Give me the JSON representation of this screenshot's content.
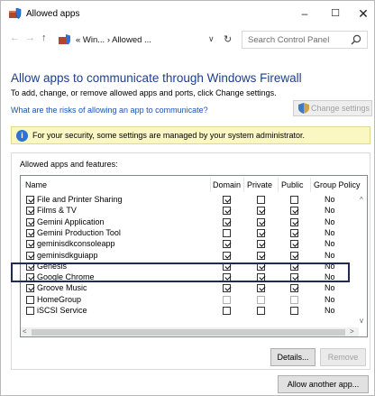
{
  "window": {
    "title": "Allowed apps",
    "minimize": "–",
    "maximize": "☐",
    "close": "✕"
  },
  "nav": {
    "back": "←",
    "forward": "→",
    "up": "↑",
    "address": "« Win... › Allowed ...",
    "dropdown": "∨",
    "refresh": "↻",
    "search_placeholder": "Search Control Panel"
  },
  "page": {
    "heading": "Allow apps to communicate through Windows Firewall",
    "subtitle": "To add, change, or remove allowed apps and ports, click Change settings.",
    "risk_link": "What are the risks of allowing an app to communicate?",
    "change_settings": "Change settings"
  },
  "banner": {
    "icon": "i",
    "text": "For your security, some settings are managed by your system administrator."
  },
  "group": {
    "label": "Allowed apps and features:",
    "columns": {
      "name": "Name",
      "domain": "Domain",
      "private": "Private",
      "public": "Public",
      "group_policy": "Group Policy"
    },
    "rows": [
      {
        "name": "File and Printer Sharing",
        "enabled": true,
        "domain": true,
        "private": false,
        "public": false,
        "gp": "No"
      },
      {
        "name": "Films & TV",
        "enabled": true,
        "domain": true,
        "private": true,
        "public": true,
        "gp": "No"
      },
      {
        "name": "Gemini Application",
        "enabled": true,
        "domain": true,
        "private": true,
        "public": true,
        "gp": "No"
      },
      {
        "name": "Gemini Production Tool",
        "enabled": true,
        "domain": false,
        "private": true,
        "public": true,
        "gp": "No"
      },
      {
        "name": "geminisdkconsoleapp",
        "enabled": true,
        "domain": true,
        "private": true,
        "public": true,
        "gp": "No"
      },
      {
        "name": "geminisdkguiapp",
        "enabled": true,
        "domain": true,
        "private": true,
        "public": true,
        "gp": "No"
      },
      {
        "name": "Genesis",
        "enabled": true,
        "domain": true,
        "private": true,
        "public": true,
        "gp": "No"
      },
      {
        "name": "Google Chrome",
        "enabled": true,
        "domain": true,
        "private": true,
        "public": true,
        "gp": "No"
      },
      {
        "name": "Groove Music",
        "enabled": true,
        "domain": true,
        "private": true,
        "public": true,
        "gp": "No"
      },
      {
        "name": "HomeGroup",
        "enabled": false,
        "domain": false,
        "private": false,
        "public": false,
        "gp": "No",
        "greyed": true
      },
      {
        "name": "iSCSI Service",
        "enabled": false,
        "domain": false,
        "private": false,
        "public": false,
        "gp": "No"
      }
    ],
    "details_button": "Details...",
    "remove_button": "Remove"
  },
  "allow_another": "Allow another app...",
  "scroll": {
    "up": "^",
    "down": "v",
    "left": "<",
    "right": ">"
  }
}
